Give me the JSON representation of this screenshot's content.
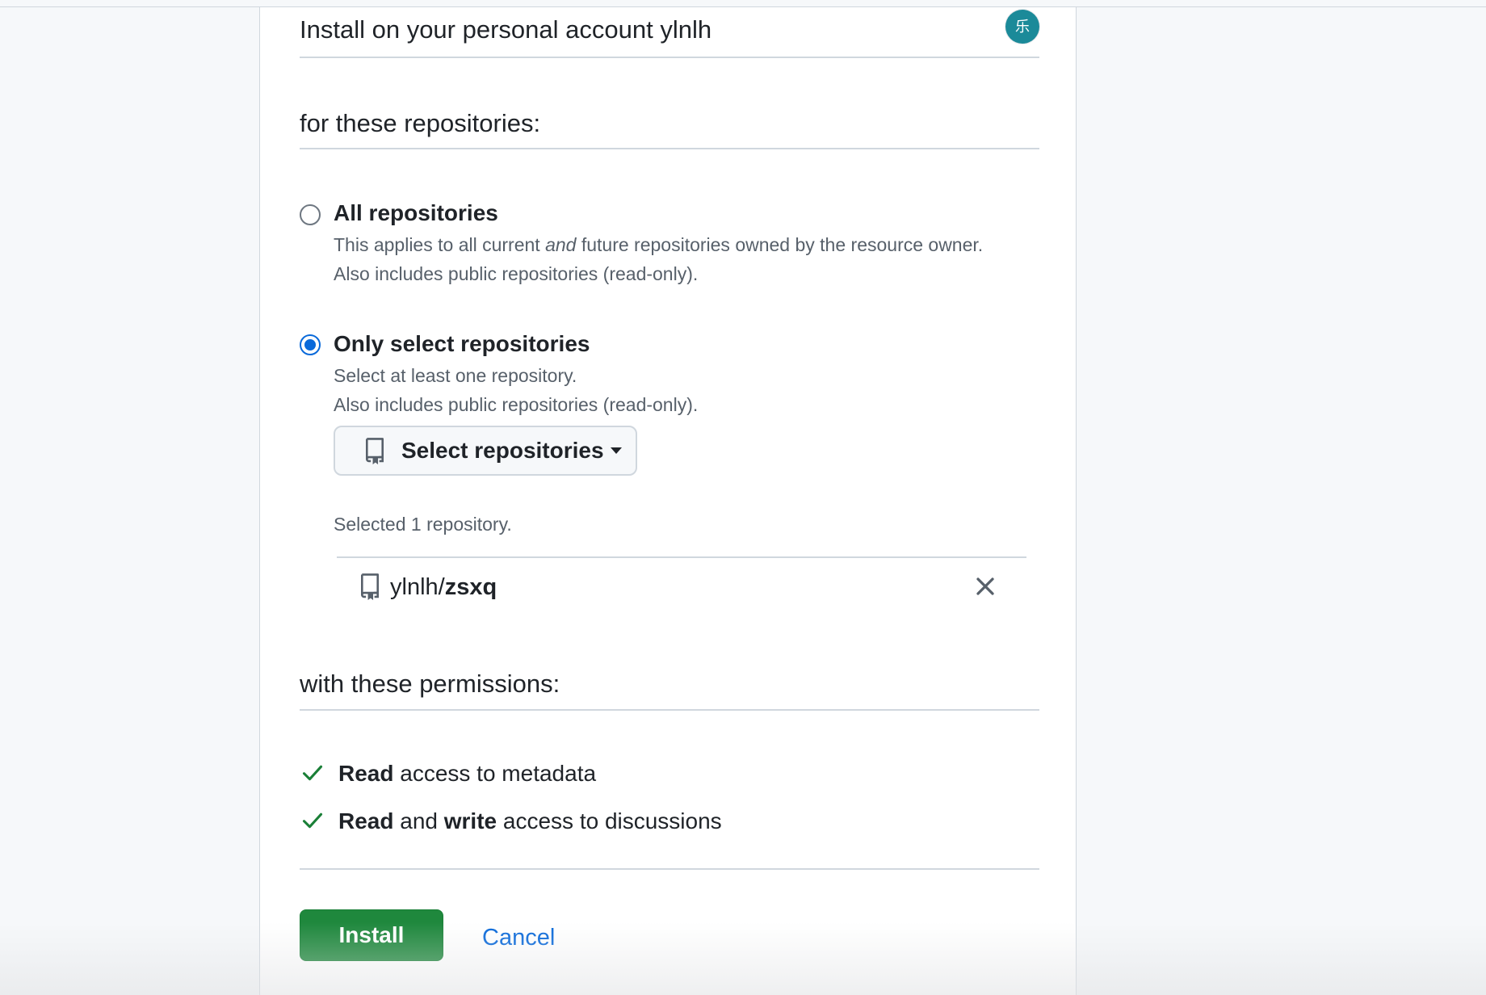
{
  "account": {
    "heading": "Install on your personal account ylnlh",
    "avatar_glyph": "乐",
    "avatar_color": "#1b8a99"
  },
  "repositories": {
    "heading": "for these repositories:",
    "all_option": {
      "title": "All repositories",
      "desc_prefix": "This applies to all current ",
      "desc_emphasis": "and",
      "desc_suffix": " future repositories owned by the resource owner.",
      "desc_line2": "Also includes public repositories (read-only).",
      "checked": false
    },
    "select_option": {
      "title": "Only select repositories",
      "desc_line1": "Select at least one repository.",
      "desc_line2": "Also includes public repositories (read-only).",
      "checked": true
    },
    "select_button_label": "Select repositories",
    "selected_count_text": "Selected 1 repository.",
    "selected_repo": {
      "owner": "ylnlh/",
      "name": "zsxq",
      "icon": "repo-icon"
    }
  },
  "permissions": {
    "heading": "with these permissions:",
    "items": [
      {
        "bold1": "Read",
        "text1": " access to metadata",
        "bold2": "",
        "text2": ""
      },
      {
        "bold1": "Read",
        "text1": " and ",
        "bold2": "write",
        "text2": " access to discussions"
      }
    ]
  },
  "actions": {
    "install_label": "Install",
    "cancel_label": "Cancel"
  },
  "colors": {
    "accent": "#0969da",
    "install_green": "#1f883d",
    "check_green": "#1a7f37"
  }
}
